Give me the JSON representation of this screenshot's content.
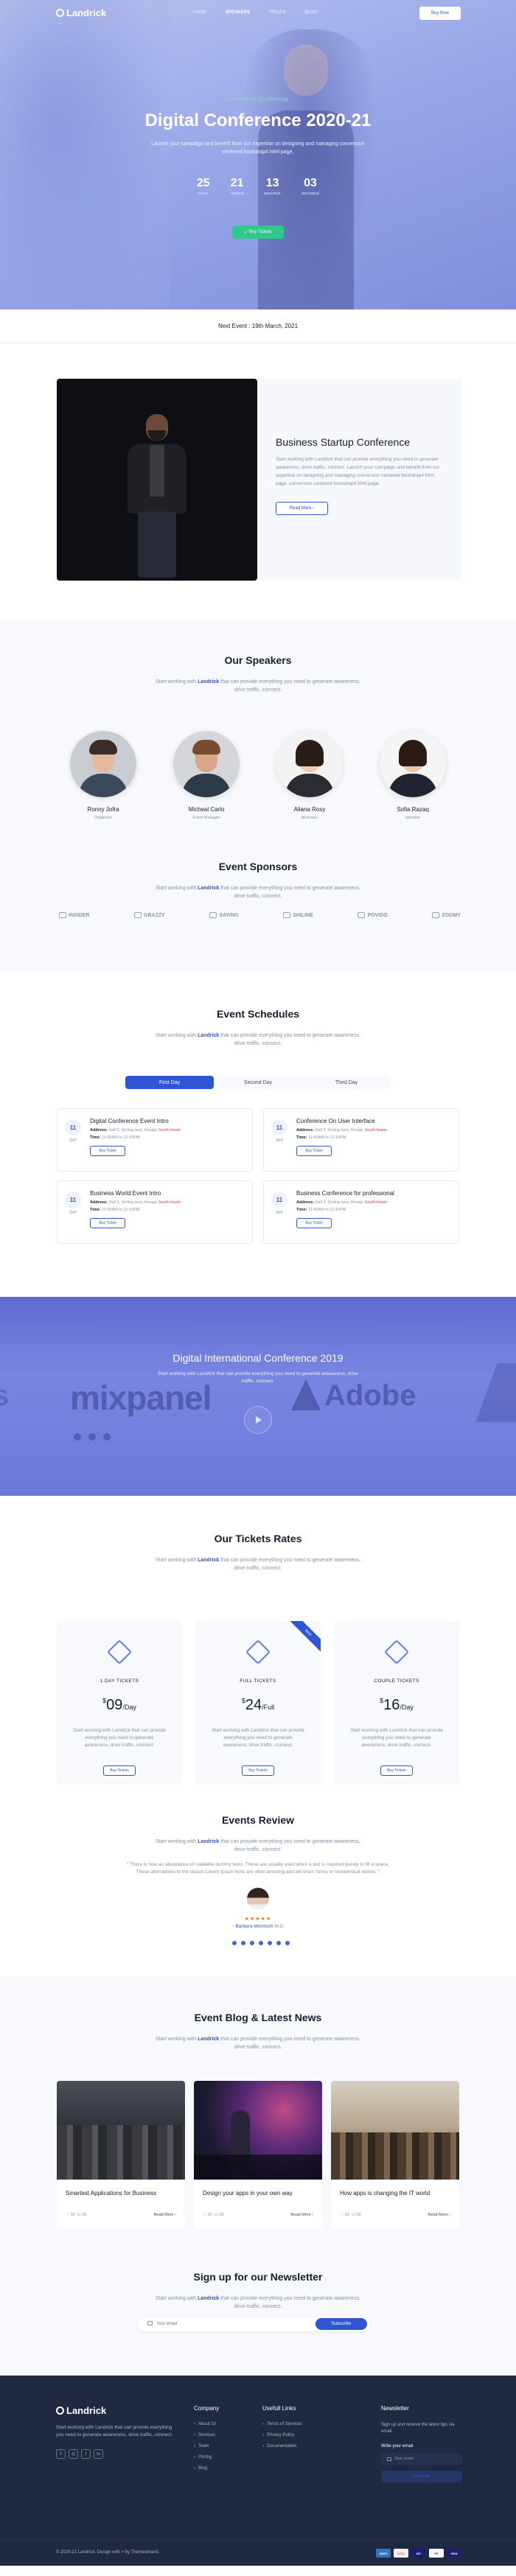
{
  "brand": {
    "name": "Landrick"
  },
  "nav": {
    "items": [
      {
        "label": "HOME"
      },
      {
        "label": "SPEAKERS",
        "active": true
      },
      {
        "label": "PRICES"
      },
      {
        "label": "BLOG"
      }
    ],
    "cta": "Buy Now"
  },
  "hero": {
    "tag": "Live Virtual Conference",
    "title": "Digital Conference 2020-21",
    "description": "Launch your campaign and benefit from our expertise on designing and managing conversion centered bootstrap4 html page.",
    "countdown": [
      {
        "value": "25",
        "label": "DAYS"
      },
      {
        "value": "21",
        "label": "HOURS"
      },
      {
        "value": "13",
        "label": "MINUTES"
      },
      {
        "value": "03",
        "label": "SECONDS"
      }
    ],
    "button": "Buy Tickets"
  },
  "next_event": "Next Event : 19th March, 2021",
  "startup": {
    "title": "Business Startup Conference",
    "description": "Start working with Landrick that can provide everything you need to generate awareness, drive traffic, connect. Launch your campaign and benefit from our expertise on designing and managing conversion centered bootstrap4 html page. conversion centered bootstrap4 html page.",
    "button": "Read More ›"
  },
  "speakers": {
    "title": "Our Speakers",
    "subtitle_prefix": "Start working with ",
    "subtitle_brand": "Landrick",
    "subtitle_suffix": " that can provide everything you need to generate awareness, drive traffic, connect.",
    "list": [
      {
        "name": "Ronny Jofra",
        "role": "Organizer"
      },
      {
        "name": "Micheal Carlo",
        "role": "Event Manager"
      },
      {
        "name": "Aliana Rosy",
        "role": "Motivator"
      },
      {
        "name": "Sofia Razaq",
        "role": "Speaker"
      }
    ]
  },
  "sponsors": {
    "title": "Event Sponsors",
    "subtitle_prefix": "Start working with ",
    "subtitle_brand": "Landrick",
    "subtitle_suffix": " that can provide everything you need to generate awareness, drive traffic, connect.",
    "logos": [
      "INSIDER",
      "GRAZZY",
      "SAYING",
      "SHILINE",
      "POVIDO",
      "ZOOMY"
    ]
  },
  "schedule": {
    "title": "Event Schedules",
    "subtitle_prefix": "Start working with ",
    "subtitle_brand": "Landrick",
    "subtitle_suffix": " that can provide everything you need to generate awareness, drive traffic, connect.",
    "tabs": [
      "First Day",
      "Second Day",
      "Third Day"
    ],
    "events": [
      {
        "day": "11",
        "month": "SEP",
        "title": "Digital Conference Event Intro",
        "address_label": "Address:",
        "address": "Hall 3, Sinling lane, Rosigo",
        "map": "South Haste",
        "time_label": "Time:",
        "time": "11:00AM to 12:15PM",
        "button": "Buy Ticket"
      },
      {
        "day": "11",
        "month": "SEP",
        "title": "Conference On User Interface",
        "address_label": "Address:",
        "address": "Hall 3, Sinling lane, Rosigo",
        "map": "South Haste",
        "time_label": "Time:",
        "time": "11:00AM to 12:15PM",
        "button": "Buy Ticket"
      },
      {
        "day": "11",
        "month": "SEP",
        "title": "Business World Event Intro",
        "address_label": "Address:",
        "address": "Hall 3, Sinling lane, Rosigo",
        "map": "South Haste",
        "time_label": "Time:",
        "time": "11:00AM to 12:15PM",
        "button": "Buy Ticket"
      },
      {
        "day": "11",
        "month": "SEP",
        "title": "Business Conference for professional",
        "address_label": "Address:",
        "address": "Hall 3, Sinling lane, Rosigo",
        "map": "South Haste",
        "time_label": "Time:",
        "time": "11:00AM to 12:15PM",
        "button": "Buy Ticket"
      }
    ]
  },
  "video": {
    "title": "Digital International Conference 2019",
    "subtitle_prefix": "Start working with ",
    "subtitle_brand": "Landrick",
    "subtitle_suffix": " that can provide everything you need to generate awareness, drive traffic, connect.",
    "bg_words": [
      "s",
      "mixpanel",
      "Adobe"
    ]
  },
  "pricing": {
    "title": "Our Tickets Rates",
    "subtitle_prefix": "Start working with ",
    "subtitle_brand": "Landrick",
    "subtitle_suffix": " that can provide everything you need to generate awareness, drive traffic, connect.",
    "plans": [
      {
        "name": "1 DAY TICKETS",
        "currency": "$",
        "price": "09",
        "unit": "/Day",
        "description": "Start working with Landrick that can provide everything you need to generate awareness, drive traffic, connect.",
        "button": "Buy Tickets"
      },
      {
        "name": "FULL TICKETS",
        "currency": "$",
        "price": "24",
        "unit": "/Full",
        "description": "Start working with Landrick that can provide everything you need to generate awareness, drive traffic, connect.",
        "button": "Buy Tickets",
        "ribbon": "Best"
      },
      {
        "name": "COUPLE TICKETS",
        "currency": "$",
        "price": "16",
        "unit": "/Day",
        "description": "Start working with Landrick that can provide everything you need to generate awareness, drive traffic, connect.",
        "button": "Buy Tickets"
      }
    ]
  },
  "review": {
    "title": "Events Review",
    "subtitle_prefix": "Start working with ",
    "subtitle_brand": "Landrick",
    "subtitle_suffix": " that can provide everything you need to generate awareness, drive traffic, connect.",
    "quote": "\" There is now an abundance of readable dummy texts. These are usually used when a text is required purely to fill a space. These alternatives to the classic Lorem Ipsum texts are often amusing and tell short, funny or nonsensical stories. \"",
    "stars": "★★★★★",
    "name": "- Barbara McIntosh",
    "name_suffix": " M.D",
    "dots": 7
  },
  "blog": {
    "title": "Event Blog & Latest News",
    "subtitle_prefix": "Start working with ",
    "subtitle_brand": "Landrick",
    "subtitle_suffix": " that can provide everything you need to generate awareness, drive traffic, connect.",
    "posts": [
      {
        "title": "Smartest Applications for Business",
        "likes": "33",
        "comments": "08",
        "more": "Read More ›"
      },
      {
        "title": "Design your apps in your own way",
        "likes": "33",
        "comments": "08",
        "more": "Read More ›"
      },
      {
        "title": "How apps is changing the IT world",
        "likes": "33",
        "comments": "08",
        "more": "Read More ›"
      }
    ]
  },
  "newsletter": {
    "title": "Sign up for our Newsletter",
    "subtitle_prefix": "Start working with ",
    "subtitle_brand": "Landrick",
    "subtitle_suffix": " that can provide everything you need to generate awareness, drive traffic, connect.",
    "placeholder": "Your email",
    "button": "Subscribe"
  },
  "footer": {
    "brand": "Landrick",
    "description": "Start working with Landrick that can provide everything you need to generate awareness, drive traffic, connect.",
    "socials": [
      "f",
      "◎",
      "t",
      "in"
    ],
    "company": {
      "title": "Company",
      "links": [
        "About Us",
        "Services",
        "Team",
        "Pricing",
        "Blog"
      ]
    },
    "useful": {
      "title": "Usefull Links",
      "links": [
        "Terms of Services",
        "Privacy Policy",
        "Documentation"
      ]
    },
    "newsletter": {
      "title": "Newsletter",
      "text": "Sign up and receive the latest tips via email.",
      "label": "Write your email",
      "placeholder": "Your email",
      "button": "Subscribe"
    },
    "copyright": "© 2020-21 Landrick. Design with ",
    "heart": "♥",
    "copyright_suffix": " by Themesbrand.",
    "cards": [
      "AMEX",
      "DISC",
      "MC",
      "PP",
      "VISA"
    ]
  },
  "colors": {
    "primary": "#2f55d4",
    "success": "#2eca8b",
    "dark": "#202942",
    "danger": "#e43f52"
  }
}
